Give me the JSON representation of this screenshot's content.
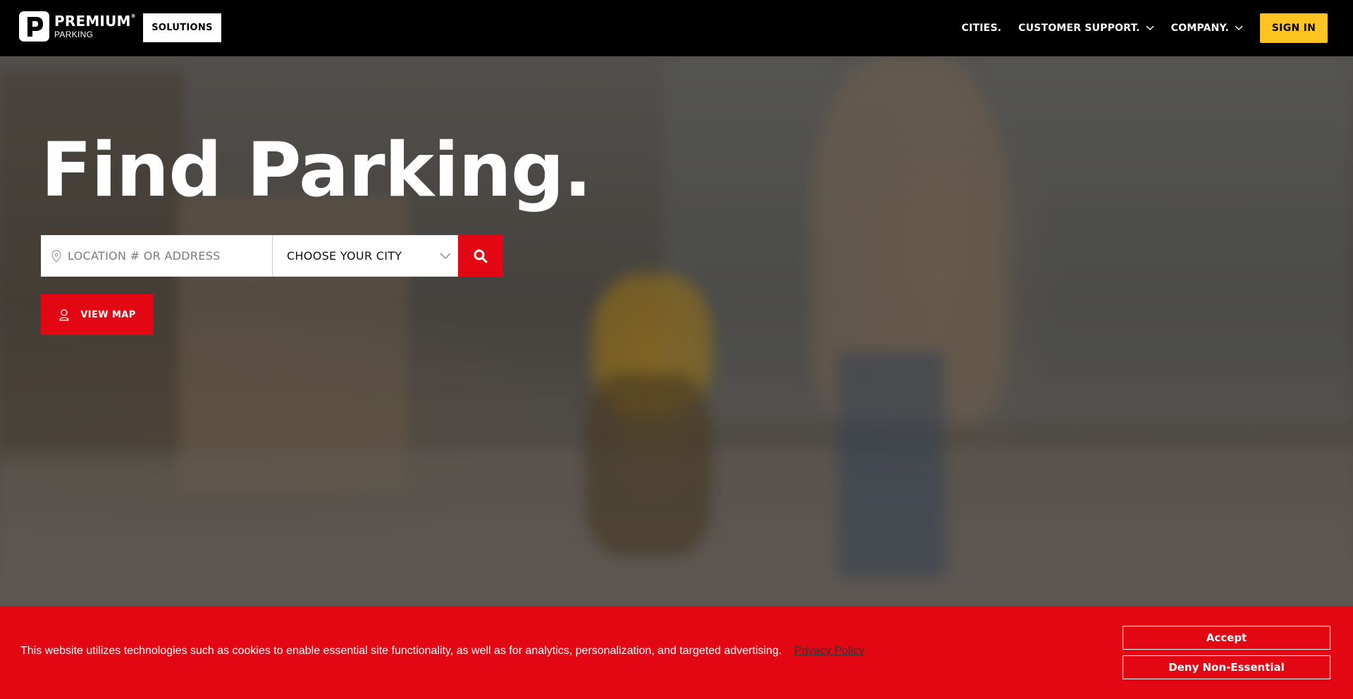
{
  "header": {
    "logo": {
      "line1": "PREMIUM",
      "line2": "PARKING"
    },
    "solutions_label": "SOLUTIONS",
    "nav": [
      {
        "label": "CITIES.",
        "has_dropdown": false
      },
      {
        "label": "CUSTOMER SUPPORT.",
        "has_dropdown": true
      },
      {
        "label": "COMPANY.",
        "has_dropdown": true
      }
    ],
    "signin_label": "SIGN IN"
  },
  "hero": {
    "title": "Find Parking.",
    "location_placeholder": "LOCATION # OR ADDRESS",
    "city_select_value": "CHOOSE YOUR CITY",
    "view_map_label": "VIEW MAP"
  },
  "cookie_banner": {
    "message": "This website utilizes technologies such as cookies to enable essential site functionality, as well as for analytics, personalization, and targeted advertising.",
    "privacy_link": "Privacy Policy",
    "accept_label": "Accept",
    "deny_label": "Deny Non-Essential"
  },
  "colors": {
    "brand_red": "#e30613",
    "brand_yellow": "#ffc420",
    "header_bg": "#000000"
  },
  "icons": [
    "p-logo-icon",
    "chevron-down-icon",
    "location-pin-icon",
    "search-icon",
    "map-marker-icon"
  ]
}
